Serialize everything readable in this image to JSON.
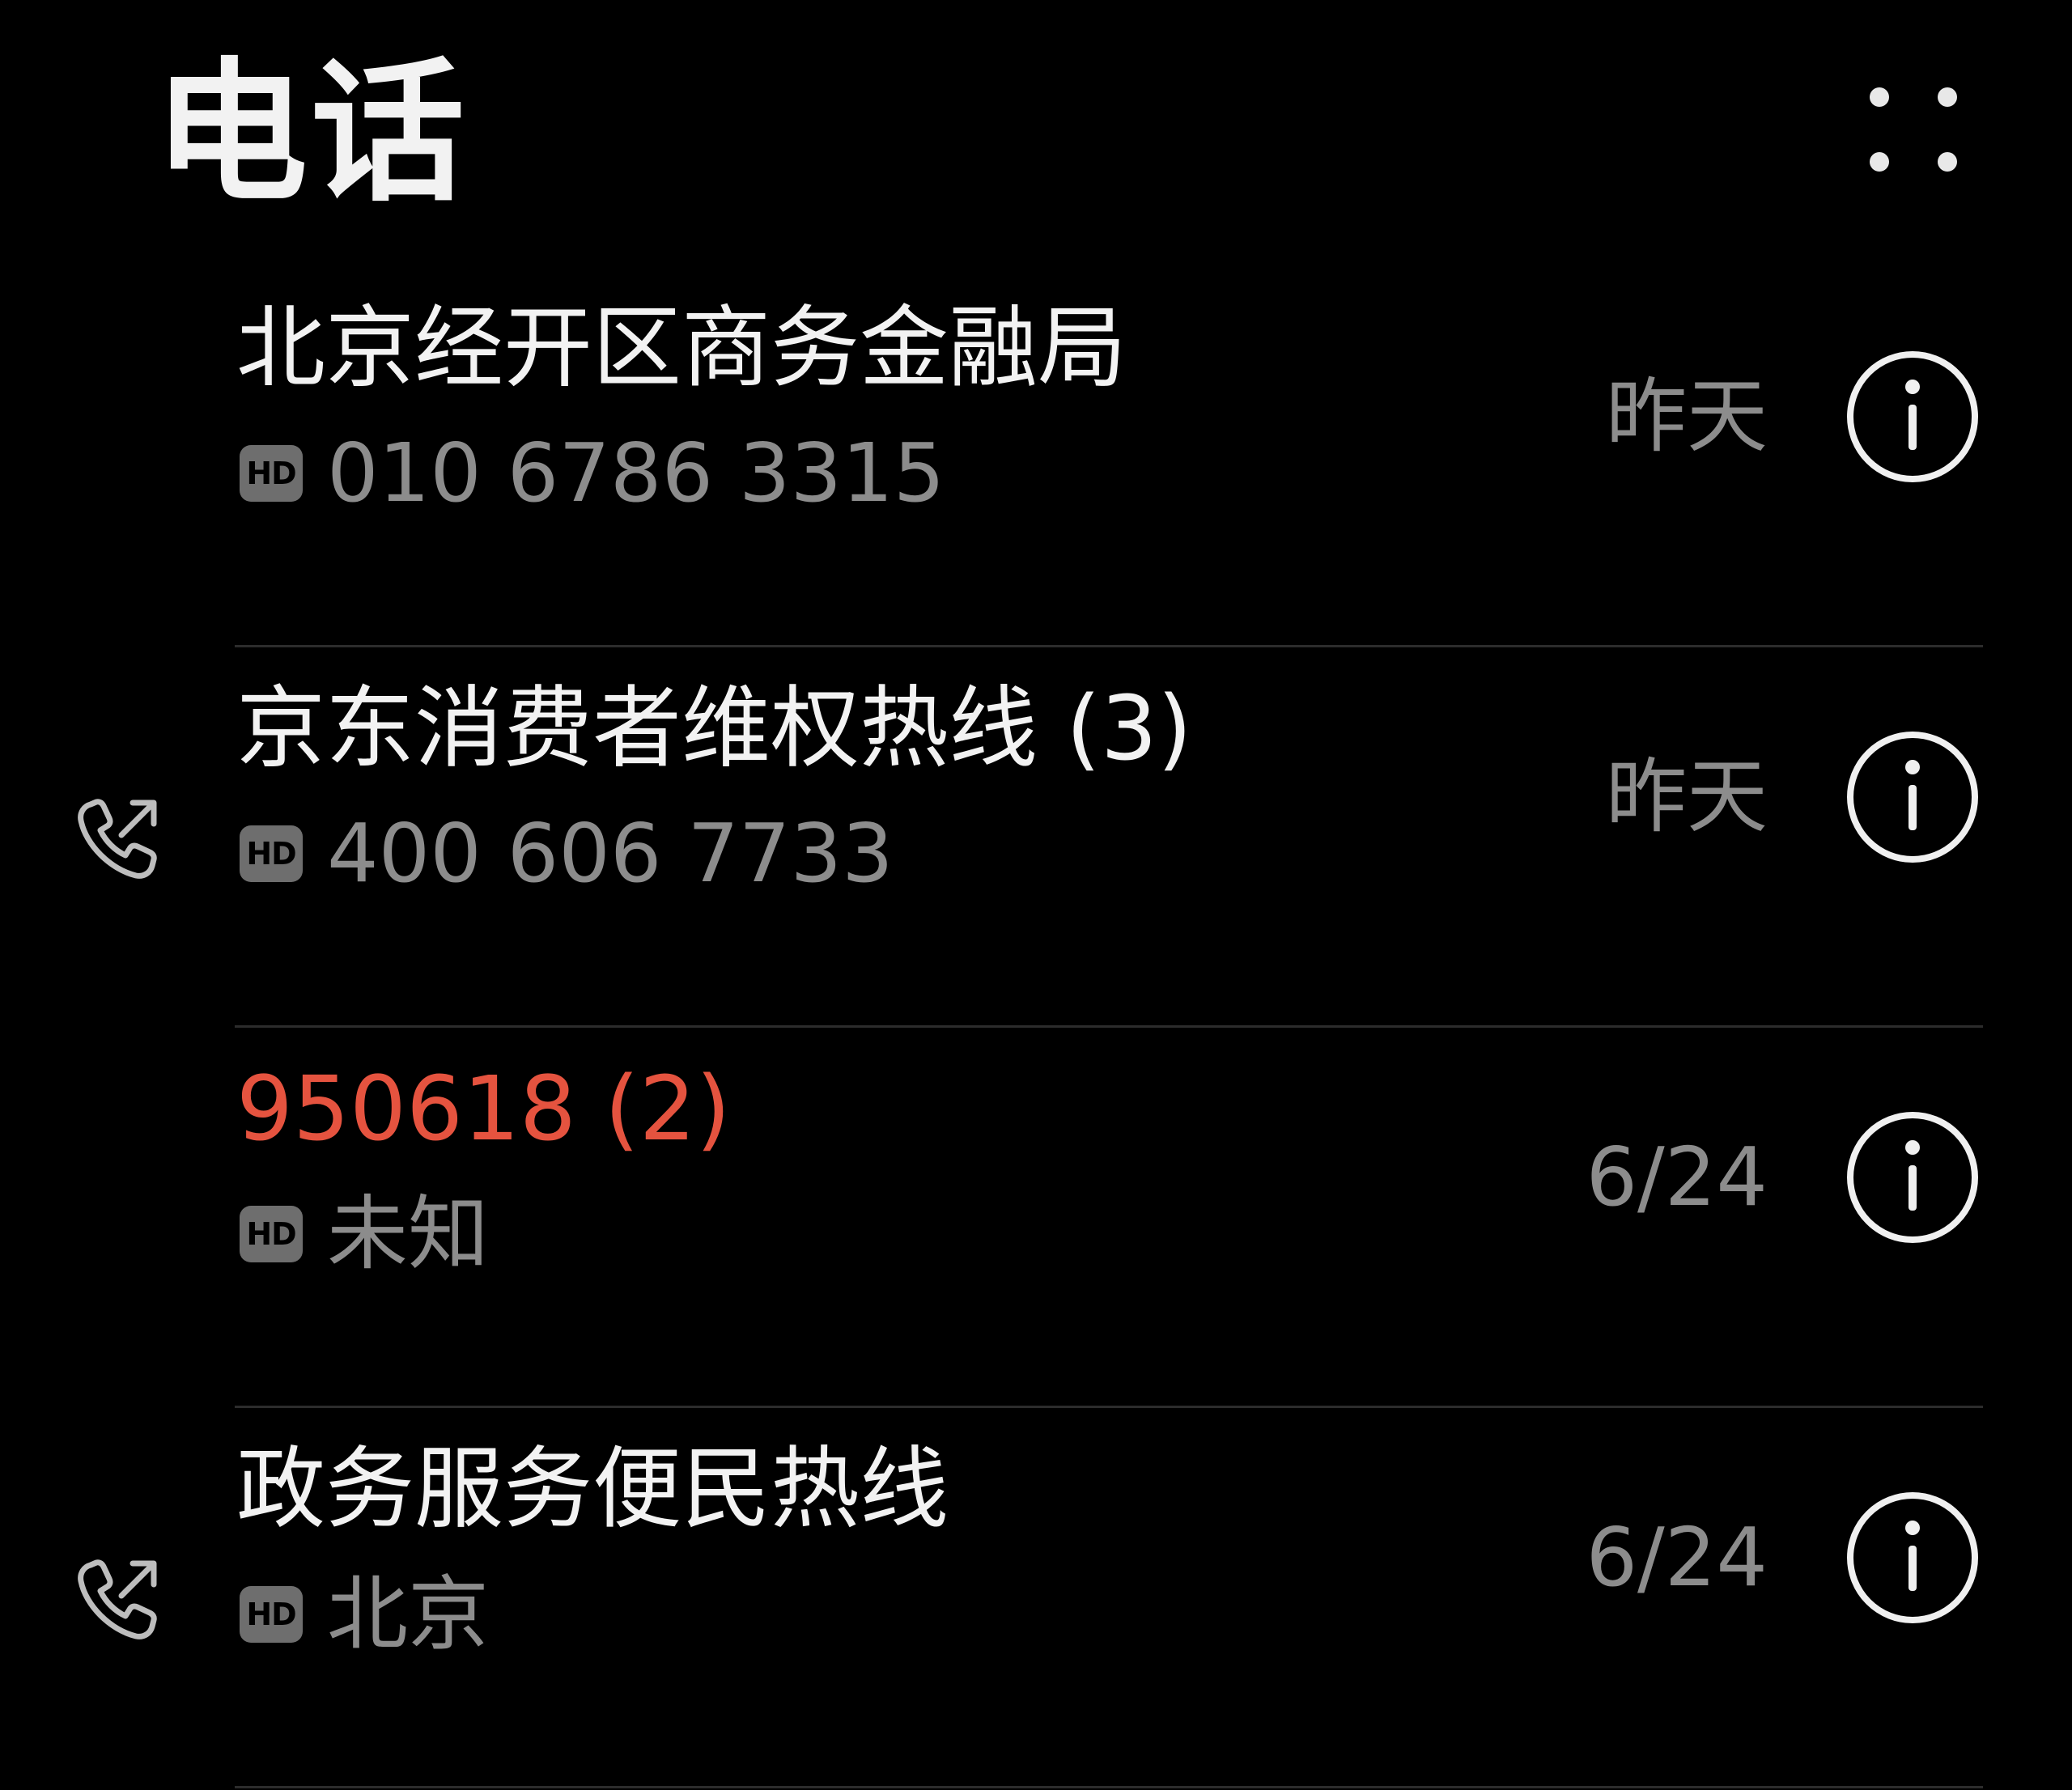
{
  "header": {
    "title": "电话",
    "menu_icon": "more-dots-icon"
  },
  "calls": [
    {
      "name": "北京经开区商务金融局",
      "badge": "HD",
      "detail": "010 6786 3315",
      "date": "昨天",
      "missed": false,
      "call_type_icon": ""
    },
    {
      "name": "京东消费者维权热线 (3)",
      "badge": "HD",
      "detail": "400 606 7733",
      "date": "昨天",
      "missed": false,
      "call_type_icon": "outgoing-call-icon"
    },
    {
      "name": "950618 (2)",
      "badge": "HD",
      "detail": "未知",
      "date": "6/24",
      "missed": true,
      "call_type_icon": ""
    },
    {
      "name": "政务服务便民热线",
      "badge": "HD",
      "detail": "北京",
      "date": "6/24",
      "missed": false,
      "call_type_icon": "outgoing-call-icon"
    }
  ],
  "colors": {
    "background": "#000000",
    "primary_text": "#f2f2f2",
    "secondary_text": "#8c8c8c",
    "missed": "#e5533f",
    "divider": "#2c2c2c"
  }
}
